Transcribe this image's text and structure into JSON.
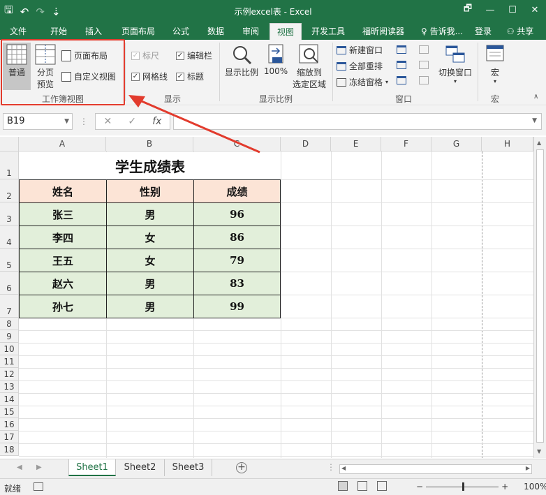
{
  "window": {
    "title": "示例excel表 - Excel",
    "qat_save": "🖫",
    "qat_undo": "↶",
    "qat_redo": "↷",
    "qat_custom": "⇣",
    "minimize": "🗗",
    "restore": "—",
    "maximize": "☐",
    "close": "✕"
  },
  "tabs": [
    {
      "label": "文件"
    },
    {
      "label": "开始"
    },
    {
      "label": "插入"
    },
    {
      "label": "页面布局"
    },
    {
      "label": "公式"
    },
    {
      "label": "数据"
    },
    {
      "label": "审阅"
    },
    {
      "label": "视图",
      "active": true
    },
    {
      "label": "开发工具"
    },
    {
      "label": "福昕阅读器"
    },
    {
      "label": "告诉我..."
    },
    {
      "label": "登录"
    },
    {
      "label": "共享"
    }
  ],
  "ribbon": {
    "workbook_views": {
      "label": "工作簿视图",
      "normal": "普通",
      "page_break_line1": "分页",
      "page_break_line2": "预览",
      "page_layout": "页面布局",
      "custom_views": "自定义视图"
    },
    "show": {
      "label": "显示",
      "ruler": "标尺",
      "formula_bar": "编辑栏",
      "gridlines": "网格线",
      "headings": "标题"
    },
    "zoom": {
      "label": "显示比例",
      "zoom": "显示比例",
      "hundred": "100%",
      "zoom_sel_line1": "缩放到",
      "zoom_sel_line2": "选定区域"
    },
    "window": {
      "label": "窗口",
      "new_window": "新建窗口",
      "arrange_all": "全部重排",
      "freeze_panes": "冻结窗格",
      "switch_windows": "切换窗口"
    },
    "macros": {
      "label": "宏",
      "macros": "宏"
    }
  },
  "formula_bar": {
    "name_box": "B19",
    "cancel": "✕",
    "enter": "✓",
    "fx": "fx",
    "value": ""
  },
  "columns": [
    "A",
    "B",
    "C",
    "D",
    "E",
    "F",
    "G",
    "H"
  ],
  "rows": [
    "1",
    "2",
    "3",
    "4",
    "5",
    "6",
    "7",
    "8",
    "9",
    "10",
    "11",
    "12",
    "13",
    "14",
    "15",
    "16",
    "17",
    "18"
  ],
  "table": {
    "title": "学生成绩表",
    "headers": [
      "姓名",
      "性别",
      "成绩"
    ],
    "rows": [
      [
        "张三",
        "男",
        "96"
      ],
      [
        "李四",
        "女",
        "86"
      ],
      [
        "王五",
        "女",
        "79"
      ],
      [
        "赵六",
        "男",
        "83"
      ],
      [
        "孙七",
        "男",
        "99"
      ]
    ]
  },
  "sheets": [
    {
      "label": "Sheet1",
      "active": true
    },
    {
      "label": "Sheet2"
    },
    {
      "label": "Sheet3"
    }
  ],
  "status": {
    "ready": "就绪",
    "zoom": "100%",
    "minus": "−",
    "plus": "+"
  },
  "colors": {
    "excel_green": "#217346",
    "header_fill": "#fce4d6",
    "data_fill": "#e2efda",
    "highlight_red": "#e23b2d"
  }
}
